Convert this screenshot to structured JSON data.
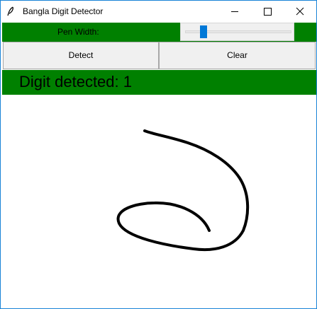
{
  "window": {
    "title": "Bangla Digit Detector",
    "app_icon": "feather-icon",
    "controls": [
      "minimize-icon",
      "maximize-icon",
      "close-icon"
    ]
  },
  "pen": {
    "label": "Pen Width:",
    "slider_value_fraction": 0.15
  },
  "buttons": {
    "detect_label": "Detect",
    "clear_label": "Clear"
  },
  "status": {
    "text": "Digit detected: 1"
  },
  "colors": {
    "panel_green": "#008000",
    "slider_accent": "#0078d7",
    "window_border": "#1883d7",
    "stroke": "#000000"
  }
}
